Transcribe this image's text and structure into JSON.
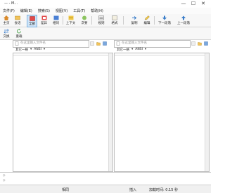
{
  "window": {
    "title": "— - M...",
    "min": "—",
    "max": "☐",
    "close": "✕"
  },
  "menu": [
    "文件(F)",
    "编辑(E)",
    "搜索(S)",
    "视图(V)",
    "工具(T)",
    "帮助(H)"
  ],
  "toolbar": {
    "home": "主页",
    "session": "会话",
    "all": "全部",
    "diff": "差异",
    "same": "相同",
    "context": "上下文",
    "minor": "次要",
    "rules": "规则",
    "format": "格式",
    "copy": "复制",
    "edit": "编辑",
    "next_section": "下一段落",
    "prev_section": "上一段落"
  },
  "toolbar2": {
    "swap": "交换",
    "reload": "重载"
  },
  "left_path": {
    "placeholder": "在这里输入文件名"
  },
  "right_path": {
    "placeholder": "在这里输入文件名"
  },
  "left_enc": {
    "lineend": "其它一格",
    "encoding": "ANSI"
  },
  "right_enc": {
    "lineend": "其它一格",
    "encoding": "ANSI"
  },
  "status": {
    "same": "相同",
    "insert": "插入",
    "load_time": "加载时间: 0.15 秒"
  },
  "colors": {
    "accent": "#3a7dc9",
    "active_bg": "#cfe4f7"
  }
}
